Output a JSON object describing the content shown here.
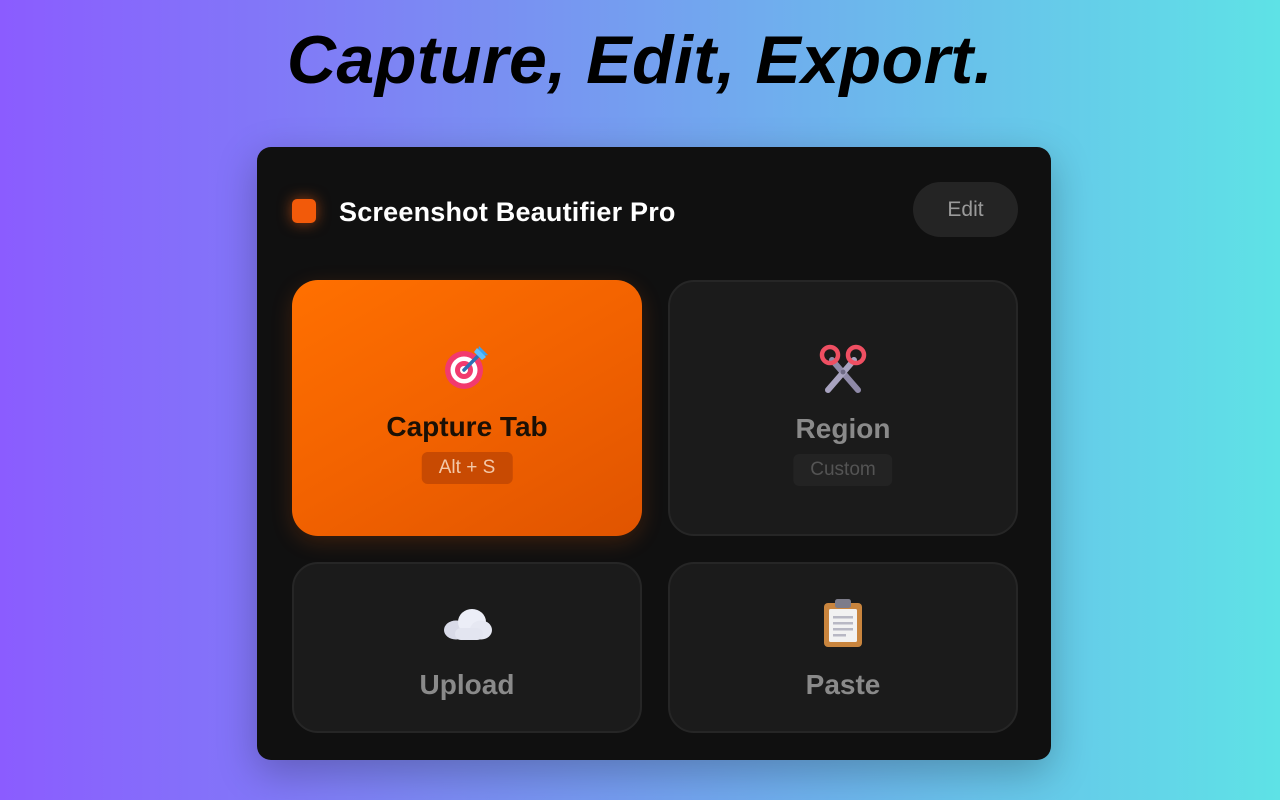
{
  "headline": "Capture, Edit, Export.",
  "app": {
    "title": "Screenshot Beautifier Pro",
    "edit_label": "Edit",
    "accent_color": "#f25a0a"
  },
  "tiles": [
    {
      "label": "Capture Tab",
      "badge": "Alt + S",
      "icon": "target-icon",
      "active": true
    },
    {
      "label": "Region",
      "badge": "Custom",
      "icon": "scissors-icon",
      "active": false
    },
    {
      "label": "Upload",
      "icon": "cloud-icon",
      "active": false
    },
    {
      "label": "Paste",
      "icon": "clipboard-icon",
      "active": false
    }
  ]
}
